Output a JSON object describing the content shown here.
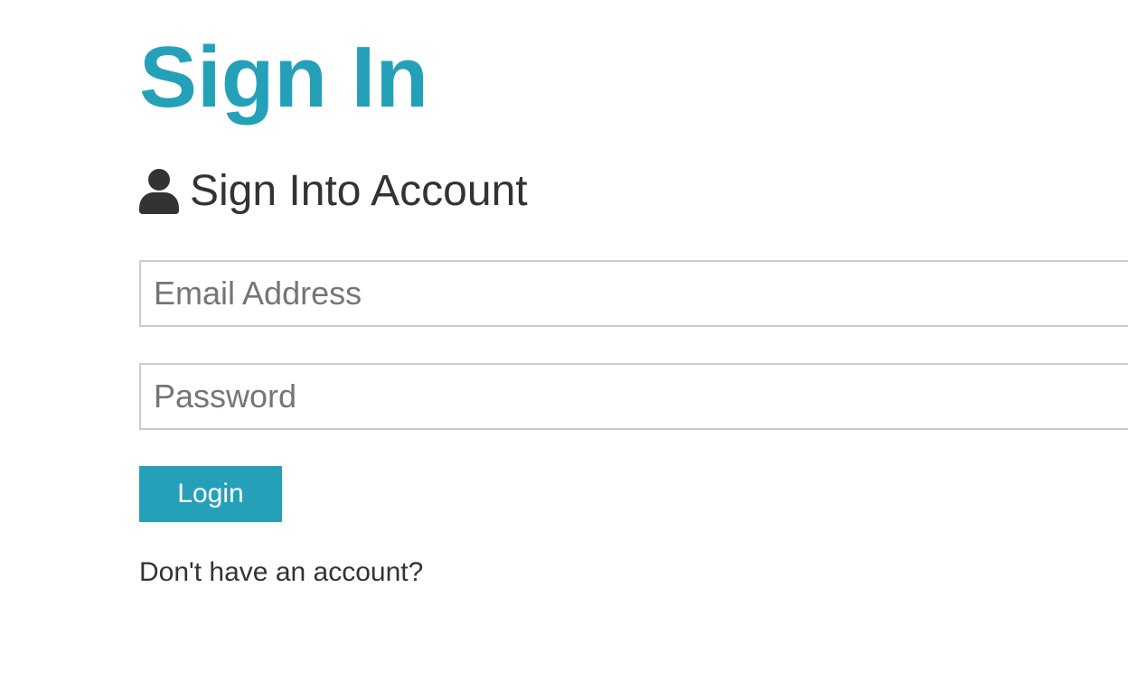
{
  "header": {
    "title": "Sign In",
    "subtitle": "Sign Into Account",
    "subtitle_icon": "user-icon"
  },
  "form": {
    "email": {
      "placeholder": "Email Address",
      "value": ""
    },
    "password": {
      "placeholder": "Password",
      "value": ""
    },
    "submit_label": "Login"
  },
  "footer": {
    "prompt": "Don't have an account?"
  },
  "colors": {
    "accent": "#24a1b8",
    "text": "#333333",
    "border": "#cccccc",
    "placeholder": "#757575"
  }
}
